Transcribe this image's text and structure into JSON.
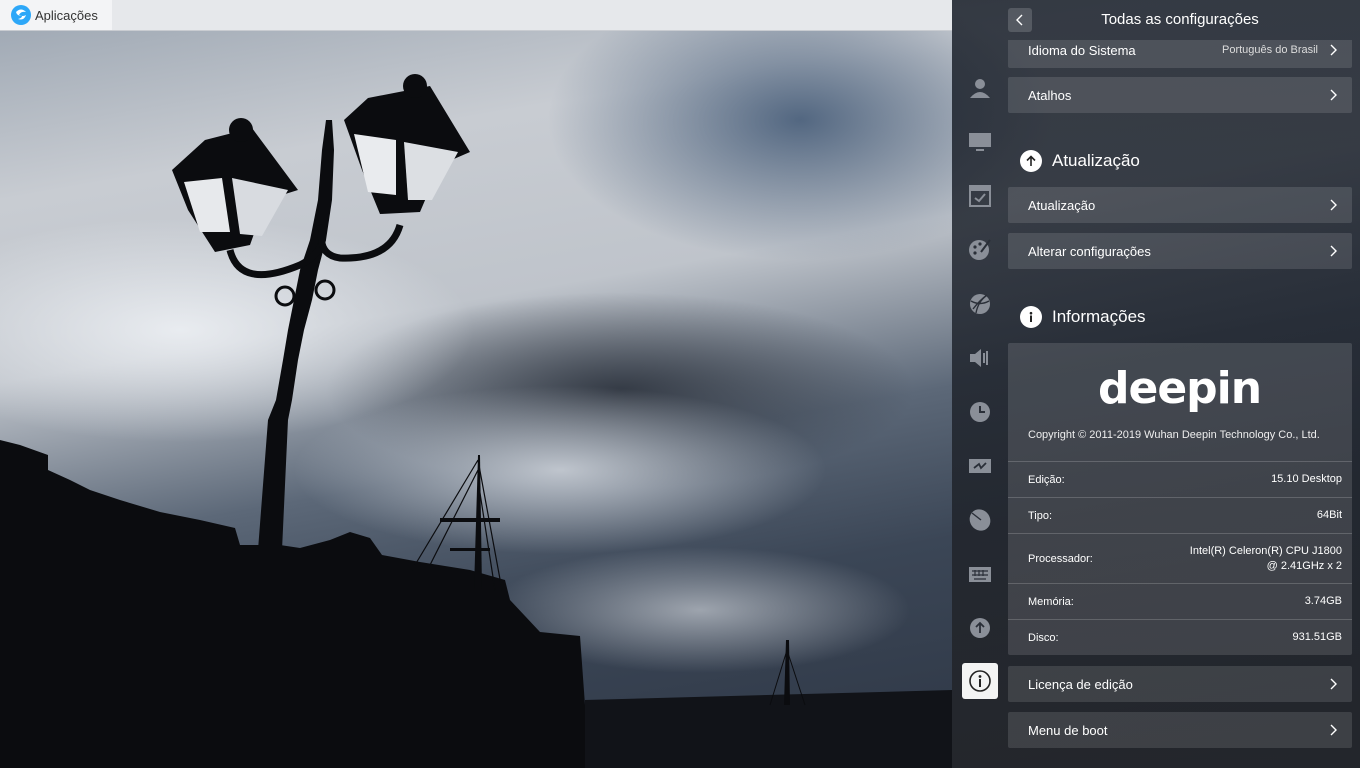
{
  "topbar": {
    "launcher_label": "Aplicações"
  },
  "panel": {
    "title": "Todas as configurações",
    "sidebar_icons": [
      "account-icon",
      "display-icon",
      "default-apps-icon",
      "personalization-icon",
      "network-icon",
      "sound-icon",
      "datetime-icon",
      "power-icon",
      "mouse-icon",
      "keyboard-icon",
      "update-icon",
      "info-icon"
    ],
    "rows_top": [
      {
        "label": "Idioma do Sistema",
        "value": "Português do Brasil"
      },
      {
        "label": "Atalhos",
        "value": ""
      }
    ],
    "update_section": {
      "title": "Atualização",
      "rows": [
        {
          "label": "Atualização"
        },
        {
          "label": "Alterar configurações"
        }
      ]
    },
    "info_section": {
      "title": "Informações",
      "logo_text": "deepin",
      "copyright": "Copyright © 2011-2019 Wuhan Deepin Technology Co., Ltd.",
      "details": [
        {
          "key": "Edição:",
          "value": "15.10 Desktop"
        },
        {
          "key": "Tipo:",
          "value": "64Bit"
        },
        {
          "key": "Processador:",
          "value": "Intel(R) Celeron(R) CPU  J1800",
          "value2": "@ 2.41GHz x 2"
        },
        {
          "key": "Memória:",
          "value": "3.74GB"
        },
        {
          "key": "Disco:",
          "value": "931.51GB"
        }
      ],
      "rows": [
        {
          "label": "Licença de edição"
        },
        {
          "label": "Menu de boot"
        }
      ]
    }
  },
  "colors": {
    "panel_bg": "#1b212c",
    "row_bg": "#3a3f48",
    "active_icon_bg": "#ffffff"
  }
}
